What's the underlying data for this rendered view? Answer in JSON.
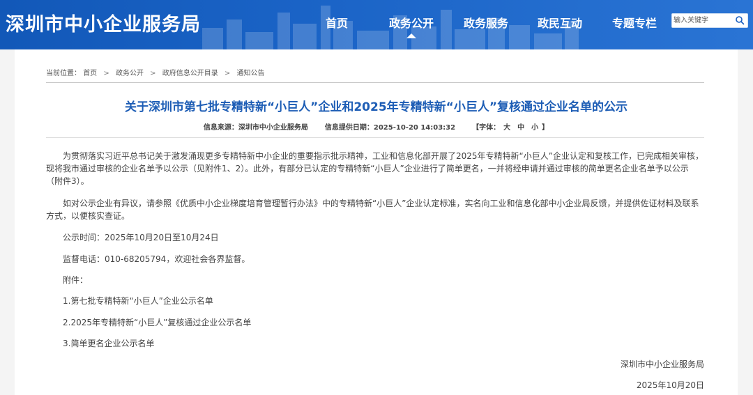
{
  "site": {
    "title": "深圳市中小企业服务局"
  },
  "nav": {
    "items": [
      {
        "label": "首页"
      },
      {
        "label": "政务公开"
      },
      {
        "label": "政务服务"
      },
      {
        "label": "政民互动"
      },
      {
        "label": "专题专栏"
      }
    ],
    "active_index": 1
  },
  "search": {
    "placeholder": "输入关键字",
    "icon": "search-icon"
  },
  "breadcrumb": {
    "prefix": "当前位置：",
    "items": [
      "首页",
      "政务公开",
      "政府信息公开目录",
      "通知公告"
    ],
    "separator": ">"
  },
  "article": {
    "title": "关于深圳市第七批专精特新“小巨人”企业和2025年专精特新“小巨人”复核通过企业名单的公示",
    "source_label": "信息来源：深圳市中小企业服务局",
    "date_label": "信息提供日期：2025-10-20 14:03:32",
    "font_open": "【字体：",
    "font_sizes": [
      "大",
      "中",
      "小"
    ],
    "font_close": "】",
    "para1": "为贯彻落实习近平总书记关于激发涌现更多专精特新中小企业的重要指示批示精神，工业和信息化部开展了2025年专精特新“小巨人”企业认定和复核工作，已完成相关审核，现将我市通过审核的企业名单予以公示（见附件1、2）。此外，有部分已认定的专精特新“小巨人”企业进行了简单更名，一并将经申请并通过审核的简单更名企业名单予以公示（附件3）。",
    "para2": "如对公示企业有异议，请参照《优质中小企业梯度培育管理暂行办法》中的专精特新“小巨人”企业认定标准，实名向工业和信息化部中小企业局反馈，并提供佐证材料及联系方式，以便核实查证。",
    "period": "公示时间：2025年10月20日至10月24日",
    "phone": "监督电话：010-68205794，欢迎社会各界监督。",
    "attach_heading": "附件：",
    "attachments": [
      "1.第七批专精特新“小巨人”企业公示名单",
      "2.2025年专精特新“小巨人”复核通过企业公示名单",
      "3.简单更名企业公示名单"
    ],
    "signature": "深圳市中小企业服务局",
    "sign_date": "2025年10月20日"
  },
  "colors": {
    "header": "#1a5fc0",
    "title": "#1d5db5"
  }
}
